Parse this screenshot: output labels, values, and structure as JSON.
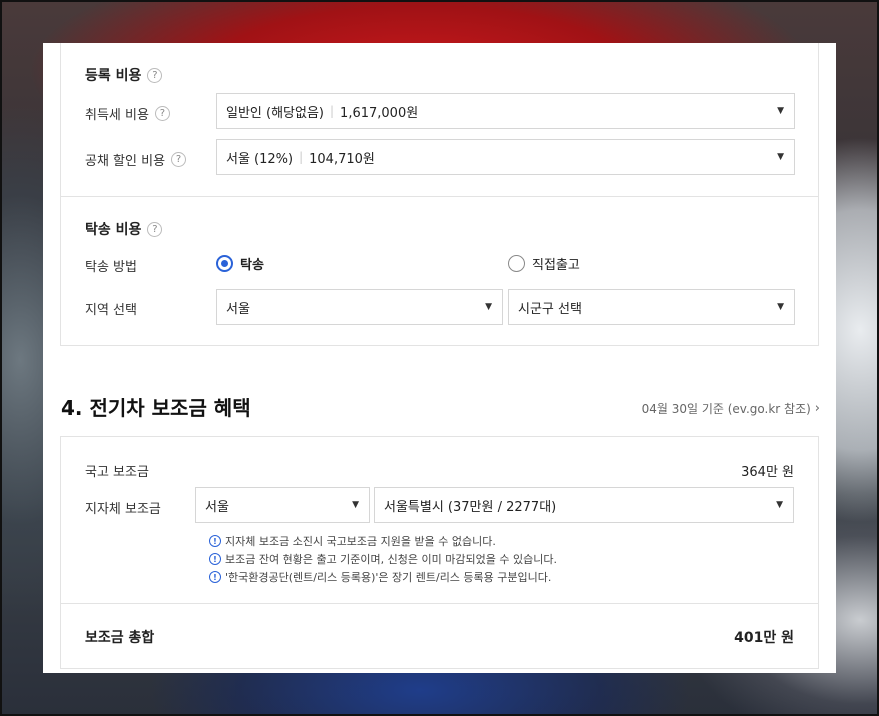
{
  "registration": {
    "heading": "등록 비용",
    "acquisition_tax": {
      "label": "취득세 비용",
      "value": "일반인 (해당없음)",
      "amount": "1,617,000원"
    },
    "bond_discount": {
      "label": "공채 할인 비용",
      "value": "서울 (12%)",
      "amount": "104,710원"
    }
  },
  "delivery": {
    "heading": "탁송 비용",
    "method_label": "탁송 방법",
    "options": [
      {
        "label": "탁송",
        "selected": true
      },
      {
        "label": "직접출고",
        "selected": false
      }
    ],
    "region_label": "지역 선택",
    "region_value": "서울",
    "district_value": "시군구 선택"
  },
  "subsidy": {
    "section_title": "4. 전기차 보조금 혜택",
    "reference": "04월 30일 기준 (ev.go.kr 참조)",
    "national_label": "국고 보조금",
    "national_amount": "364만 원",
    "local_label": "지자체 보조금",
    "local_region": "서울",
    "local_detail": "서울특별시 (37만원 / 2277대)",
    "notes": [
      "지자체 보조금 소진시 국고보조금 지원을 받을 수 없습니다.",
      "보조금 잔여 현황은 출고 기준이며, 신청은 이미 마감되었을 수 있습니다.",
      "'한국환경공단(렌트/리스 등록용)'은 장기 렌트/리스 등록용 구분입니다."
    ],
    "total_label": "보조금 총합",
    "total_amount": "401만 원"
  },
  "icons": {
    "help": "?",
    "info": "!",
    "caret": "▼",
    "chevron": "›"
  },
  "colors": {
    "accent": "#2a62d8"
  }
}
